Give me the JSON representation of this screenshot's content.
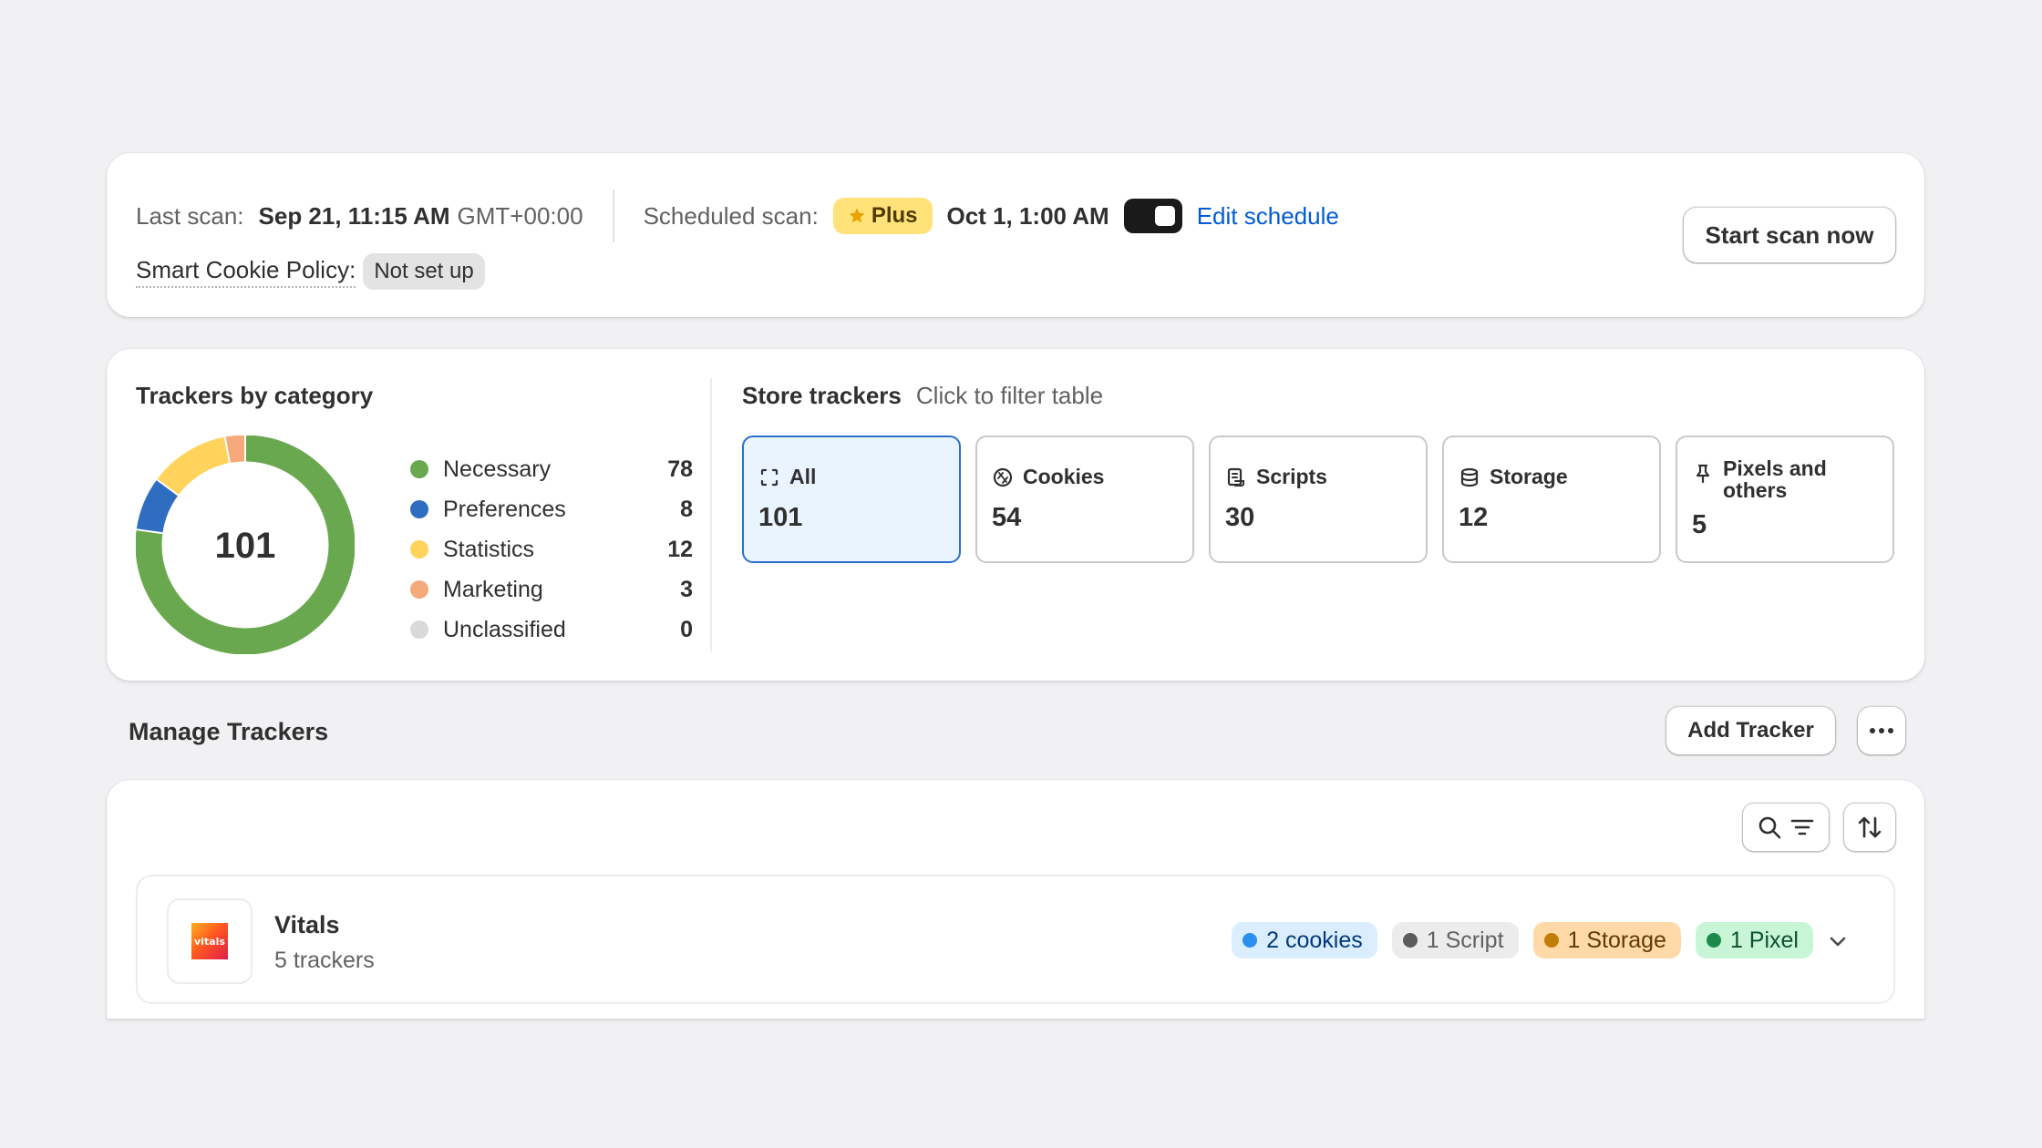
{
  "scan": {
    "last_scan_label": "Last scan:",
    "last_scan_time": "Sep 21, 11:15 AM",
    "last_scan_tz": "GMT+00:00",
    "scheduled_label": "Scheduled scan:",
    "plan_badge": "Plus",
    "scheduled_time": "Oct 1, 1:00 AM",
    "schedule_enabled": true,
    "edit_schedule": "Edit schedule",
    "policy_label": "Smart Cookie Policy:",
    "policy_status": "Not set up",
    "start_button": "Start scan now"
  },
  "categories": {
    "title": "Trackers by category",
    "total": "101",
    "items": [
      {
        "label": "Necessary",
        "value": "78",
        "color": "#6aa84f"
      },
      {
        "label": "Preferences",
        "value": "8",
        "color": "#2f6dc1"
      },
      {
        "label": "Statistics",
        "value": "12",
        "color": "#ffd35c"
      },
      {
        "label": "Marketing",
        "value": "3",
        "color": "#f6a97a"
      },
      {
        "label": "Unclassified",
        "value": "0",
        "color": "#d9d9d9"
      }
    ]
  },
  "store": {
    "title": "Store trackers",
    "hint": "Click to filter table",
    "tiles": [
      {
        "label": "All",
        "count": "101",
        "icon": "select-all-icon",
        "active": true
      },
      {
        "label": "Cookies",
        "count": "54",
        "icon": "cookie-icon"
      },
      {
        "label": "Scripts",
        "count": "30",
        "icon": "script-icon"
      },
      {
        "label": "Storage",
        "count": "12",
        "icon": "database-icon"
      },
      {
        "label": "Pixels and others",
        "count": "5",
        "icon": "pin-icon"
      }
    ]
  },
  "manage": {
    "title": "Manage Trackers",
    "add_button": "Add Tracker",
    "more_icon": "ellipsis-icon",
    "search_icon": "search-icon",
    "filter_icon": "filter-icon",
    "sort_icon": "sort-icon",
    "rows": [
      {
        "logo_text": "vitals",
        "name": "Vitals",
        "subtitle": "5 trackers",
        "badges": [
          {
            "label": "2 cookies",
            "bg": "#dbeeff",
            "dot": "#2b8ff0",
            "fg": "#003a7a"
          },
          {
            "label": "1 Script",
            "bg": "#ececec",
            "dot": "#5c5c5c",
            "fg": "#616161"
          },
          {
            "label": "1 Storage",
            "bg": "#ffd9a8",
            "dot": "#c17d0a",
            "fg": "#5e3b00"
          },
          {
            "label": "1 Pixel",
            "bg": "#c8f5d6",
            "dot": "#1b8a4a",
            "fg": "#0c5132"
          }
        ]
      }
    ]
  }
}
